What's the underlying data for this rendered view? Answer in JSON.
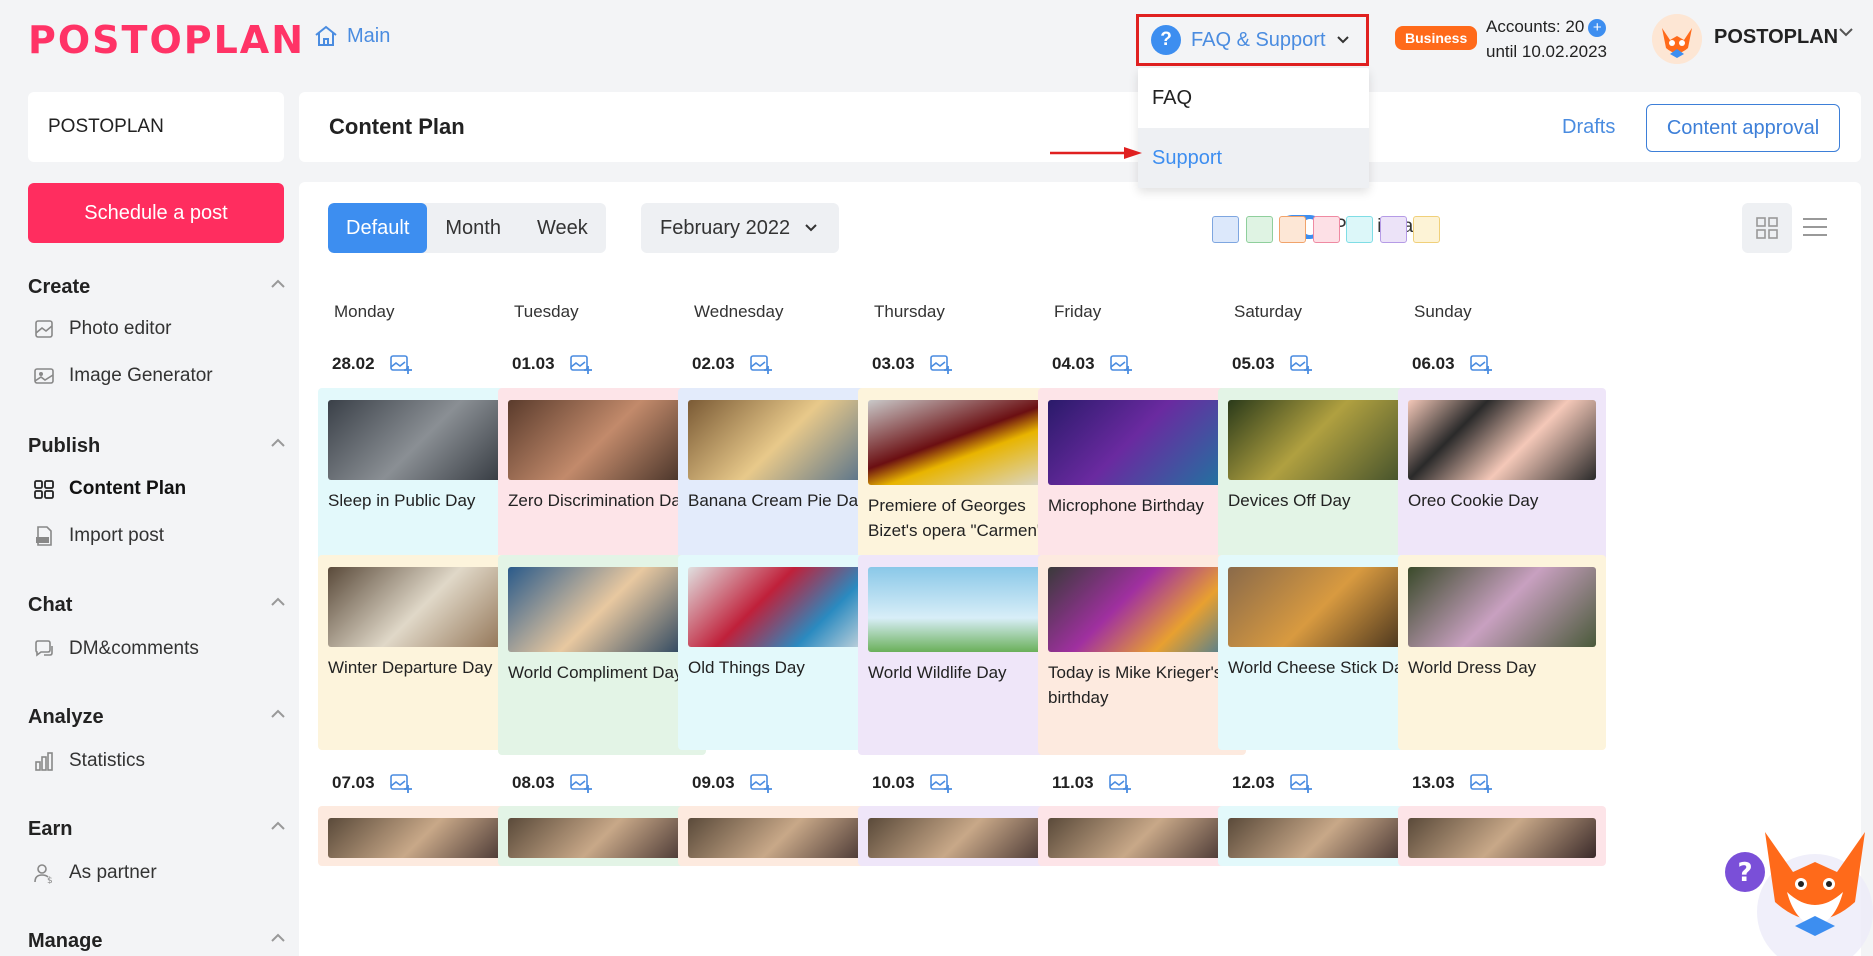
{
  "header": {
    "logo": "POSTOPLAN",
    "main_link": "Main",
    "faq_label": "FAQ & Support",
    "plan_badge": "Business",
    "accounts_label": "Accounts: 20",
    "accounts_until": "until 10.02.2023",
    "user_name": "POSTOPLAN"
  },
  "faq_menu": {
    "items": [
      "FAQ",
      "Support"
    ],
    "highlighted": "Support"
  },
  "sidebar": {
    "workspace": "POSTOPLAN",
    "schedule_button": "Schedule a post",
    "sections": [
      {
        "title": "Create",
        "items": [
          {
            "label": "Photo editor",
            "icon": "photo-editor-icon"
          },
          {
            "label": "Image Generator",
            "icon": "image-icon"
          }
        ]
      },
      {
        "title": "Publish",
        "items": [
          {
            "label": "Content Plan",
            "icon": "grid-icon",
            "active": true
          },
          {
            "label": "Import post",
            "icon": "csv-file-icon"
          }
        ]
      },
      {
        "title": "Chat",
        "items": [
          {
            "label": "DM&comments",
            "icon": "chat-icon"
          }
        ]
      },
      {
        "title": "Analyze",
        "items": [
          {
            "label": "Statistics",
            "icon": "bar-chart-icon"
          }
        ]
      },
      {
        "title": "Earn",
        "items": [
          {
            "label": "As partner",
            "icon": "partner-icon"
          }
        ]
      },
      {
        "title": "Manage",
        "items": []
      }
    ]
  },
  "content_plan": {
    "title": "Content Plan",
    "drafts": "Drafts",
    "approval_button": "Content approval"
  },
  "toolbar": {
    "views": [
      "Default",
      "Month",
      "Week"
    ],
    "active_view": "Default",
    "month": "February 2022",
    "post_ideas_label": "Post ideas",
    "post_ideas_on": true,
    "swatches": [
      "#dce8fb",
      "#dff3e3",
      "#fde7d6",
      "#fde0e6",
      "#dcf7f9",
      "#ece3f8",
      "#fdf3d6"
    ]
  },
  "calendar": {
    "weekdays": [
      "Monday",
      "Tuesday",
      "Wednesday",
      "Thursday",
      "Friday",
      "Saturday",
      "Sunday"
    ],
    "week1_dates": [
      "28.02",
      "01.03",
      "02.03",
      "03.03",
      "04.03",
      "05.03",
      "06.03"
    ],
    "week2_dates": [
      "07.03",
      "08.03",
      "09.03",
      "10.03",
      "11.03",
      "12.03",
      "13.03"
    ],
    "row1": [
      "Sleep in Public Day",
      "Zero Discrimination Day",
      "Banana Cream Pie Day",
      "Premiere of Georges Bizet's opera \"Carmen\"",
      "Microphone Birthday",
      "Devices Off Day",
      "Oreo Cookie Day"
    ],
    "row2": [
      "Winter Departure Day",
      "World Compliment Day",
      "Old Things Day",
      "World Wildlife Day",
      "Today is Mike Krieger's birthday",
      "World Cheese Stick Day",
      "World Dress Day"
    ]
  },
  "colors": {
    "accent": "#3d8ef0",
    "brand": "#ff2d5f",
    "highlight_border": "#e02020"
  }
}
